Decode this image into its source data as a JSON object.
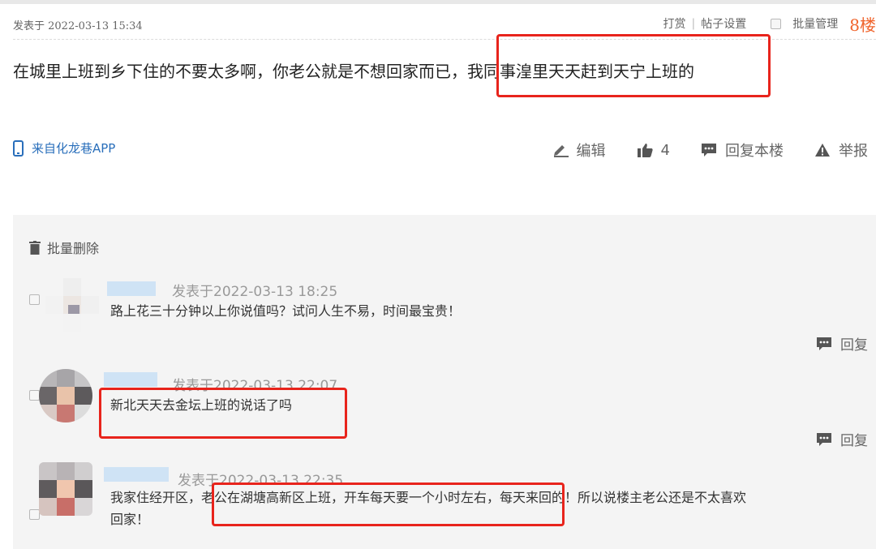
{
  "post": {
    "time_label": "发表于 2022-03-13 15:34",
    "reward": "打赏",
    "separator": "|",
    "settings": "帖子设置",
    "batch_manage": "批量管理",
    "floor": "8楼",
    "content_prefix": "在城里上班到乡下住的不要太多啊，你老公就是不想回家而已，",
    "content_highlight": "我同事湟里天天赶到天宁上班的",
    "source": "来自化龙巷APP",
    "actions": {
      "edit": "编辑",
      "like_count": "4",
      "reply_floor": "回复本楼",
      "report": "举报"
    }
  },
  "replies_panel": {
    "batch_delete": "批量删除",
    "replies": [
      {
        "time": "发表于2022-03-13 18:25",
        "text": "路上花三十分钟以上你说值吗？试问人生不易，时间最宝贵！",
        "reply_label": "回复"
      },
      {
        "time": "发表于2022-03-13 22:07",
        "text": "新北天天去金坛上班的说话了吗",
        "reply_label": "回复"
      },
      {
        "time": "发表于2022-03-13 22:35",
        "text_before": "我家住经开区，",
        "text_highlight": "老公在湖塘高新区上班，开车每天要一个小时左右，",
        "text_after": "每天来回的！所以说楼主老公还是不太喜欢",
        "text_line2": "回家！"
      }
    ]
  },
  "colors": {
    "highlight_box": "#e8241c",
    "floor_number": "#f0642c",
    "link_blue": "#2a6fbb",
    "panel_bg": "#f4f4f4"
  },
  "icons": {
    "source": "phone-icon",
    "edit": "pencil-icon",
    "like": "thumbs-up-icon",
    "reply": "chat-bubble-icon",
    "report": "warning-icon",
    "delete": "trash-icon"
  }
}
